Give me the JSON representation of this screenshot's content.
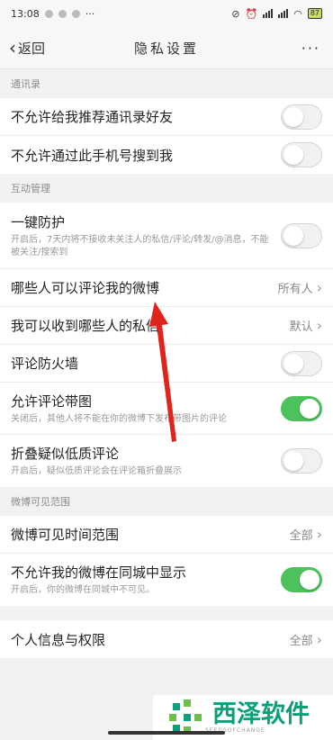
{
  "status_bar": {
    "time": "13:08",
    "dots": "···",
    "battery": "87"
  },
  "nav": {
    "back_label": "返回",
    "title": "隐私设置",
    "more": "···"
  },
  "sections": {
    "contacts": {
      "header": "通讯录",
      "rows": [
        {
          "label": "不允许给我推荐通讯录好友",
          "toggle": false
        },
        {
          "label": "不允许通过此手机号搜到我",
          "toggle": false
        }
      ]
    },
    "interaction": {
      "header": "互动管理",
      "one_click": {
        "label": "一键防护",
        "desc": "开启后，7天内将不接收未关注人的私信/评论/转发/@消息，不能被关注/搜索到",
        "toggle": false
      },
      "who_comment": {
        "label": "哪些人可以评论我的微博",
        "value": "所有人"
      },
      "who_message": {
        "label": "我可以收到哪些人的私信",
        "value": "默认"
      },
      "firewall": {
        "label": "评论防火墙",
        "toggle": false
      },
      "allow_images": {
        "label": "允许评论带图",
        "desc": "关闭后，其他人将不能在你的微博下发布带图片的评论",
        "toggle": true
      },
      "fold_low": {
        "label": "折叠疑似低质评论",
        "desc": "开启后，疑似低质评论会在评论箱折叠展示",
        "toggle": false
      }
    },
    "visibility": {
      "header": "微博可见范围",
      "time_range": {
        "label": "微博可见时间范围",
        "value": "全部"
      },
      "same_city": {
        "label": "不允许我的微博在同城中显示",
        "desc": "开启后，你的微博在同城中不可见。",
        "toggle": true
      }
    },
    "personal": {
      "label": "个人信息与权限",
      "value": "全部"
    }
  },
  "watermark": {
    "text": "西泽软件",
    "sub": "SEEDSOFCHANGE"
  },
  "colors": {
    "toggle_on": "#4cc15c",
    "arrow_red": "#e0231b",
    "watermark_green": "#0aa07a"
  }
}
